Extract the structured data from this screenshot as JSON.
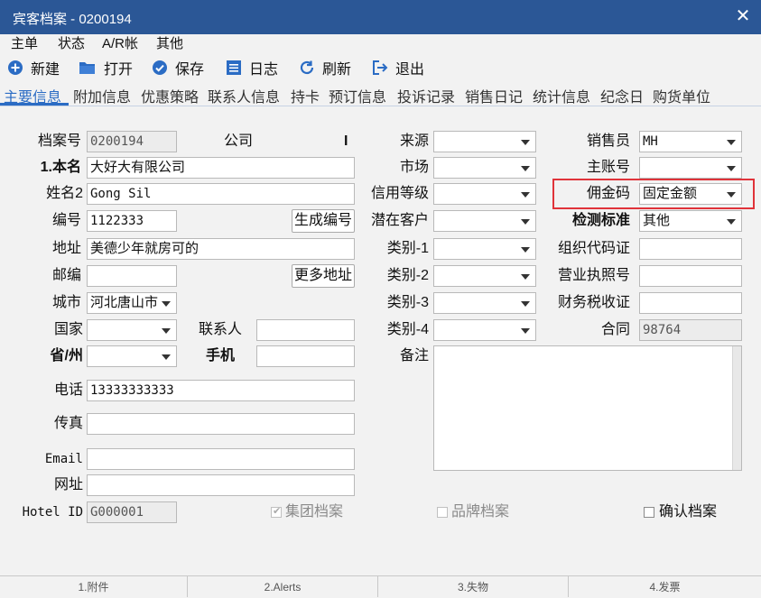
{
  "window": {
    "title": "宾客档案 - 0200194"
  },
  "menu": [
    "主单",
    "状态",
    "A/R帐",
    "其他"
  ],
  "toolbar": {
    "new": "新建",
    "open": "打开",
    "save": "保存",
    "log": "日志",
    "refresh": "刷新",
    "exit": "退出"
  },
  "tabs": [
    "主要信息",
    "附加信息",
    "优惠策略",
    "联系人信息",
    "持卡",
    "预订信息",
    "投诉记录",
    "销售日记",
    "统计信息",
    "纪念日",
    "购货单位"
  ],
  "left": {
    "file_no_label": "档案号",
    "file_no": "0200194",
    "company_label": "公司",
    "company_flag": "I",
    "name1_label": "1.本名",
    "name1": "大好大有限公司",
    "name2_label": "姓名2",
    "name2": "Gong Sil",
    "code_label": "编号",
    "code": "1122333",
    "gen_code_btn": "生成编号",
    "address_label": "地址",
    "address": "美德少年就房可的",
    "zip_label": "邮编",
    "zip": "",
    "more_addr_btn": "更多地址",
    "city_label": "城市",
    "city": "河北唐山市",
    "country_label": "国家",
    "country": "",
    "contact_label": "联系人",
    "contact": "",
    "province_label": "省/州",
    "province": "",
    "mobile_label": "手机",
    "mobile": "",
    "phone_label": "电话",
    "phone": "13333333333",
    "fax_label": "传真",
    "fax": "",
    "email_label": "Email",
    "email": "",
    "website_label": "网址",
    "website": "",
    "hotel_id_label": "Hotel ID",
    "hotel_id": "G000001"
  },
  "middle": {
    "source_label": "来源",
    "source": "",
    "market_label": "市场",
    "market": "",
    "credit_label": "信用等级",
    "credit": "",
    "potential_label": "潜在客户",
    "potential": "",
    "cat1_label": "类别-1",
    "cat1": "",
    "cat2_label": "类别-2",
    "cat2": "",
    "cat3_label": "类别-3",
    "cat3": "",
    "cat4_label": "类别-4",
    "cat4": "",
    "remark_label": "备注",
    "remark": ""
  },
  "right": {
    "sales_label": "销售员",
    "sales": "MH",
    "master_acct_label": "主账号",
    "master_acct": "",
    "commission_label": "佣金码",
    "commission": "固定金额",
    "check_std_label": "检测标准",
    "check_std": "其他",
    "org_code_label": "组织代码证",
    "org_code": "",
    "biz_license_label": "营业执照号",
    "biz_license": "",
    "tax_label": "财务税收证",
    "tax": "",
    "contract_label": "合同",
    "contract": "98764"
  },
  "checkboxes": {
    "group_file": "集团档案",
    "group_file_checked": true,
    "brand_file": "品牌档案",
    "brand_file_checked": false,
    "confirm_file": "确认档案",
    "confirm_file_checked": false
  },
  "bottom_tabs": [
    "1.附件",
    "2.Alerts",
    "3.失物",
    "4.发票"
  ],
  "colors": {
    "titlebar": "#2b5796",
    "accent": "#2b6cc4",
    "highlight": "#e0333a"
  }
}
